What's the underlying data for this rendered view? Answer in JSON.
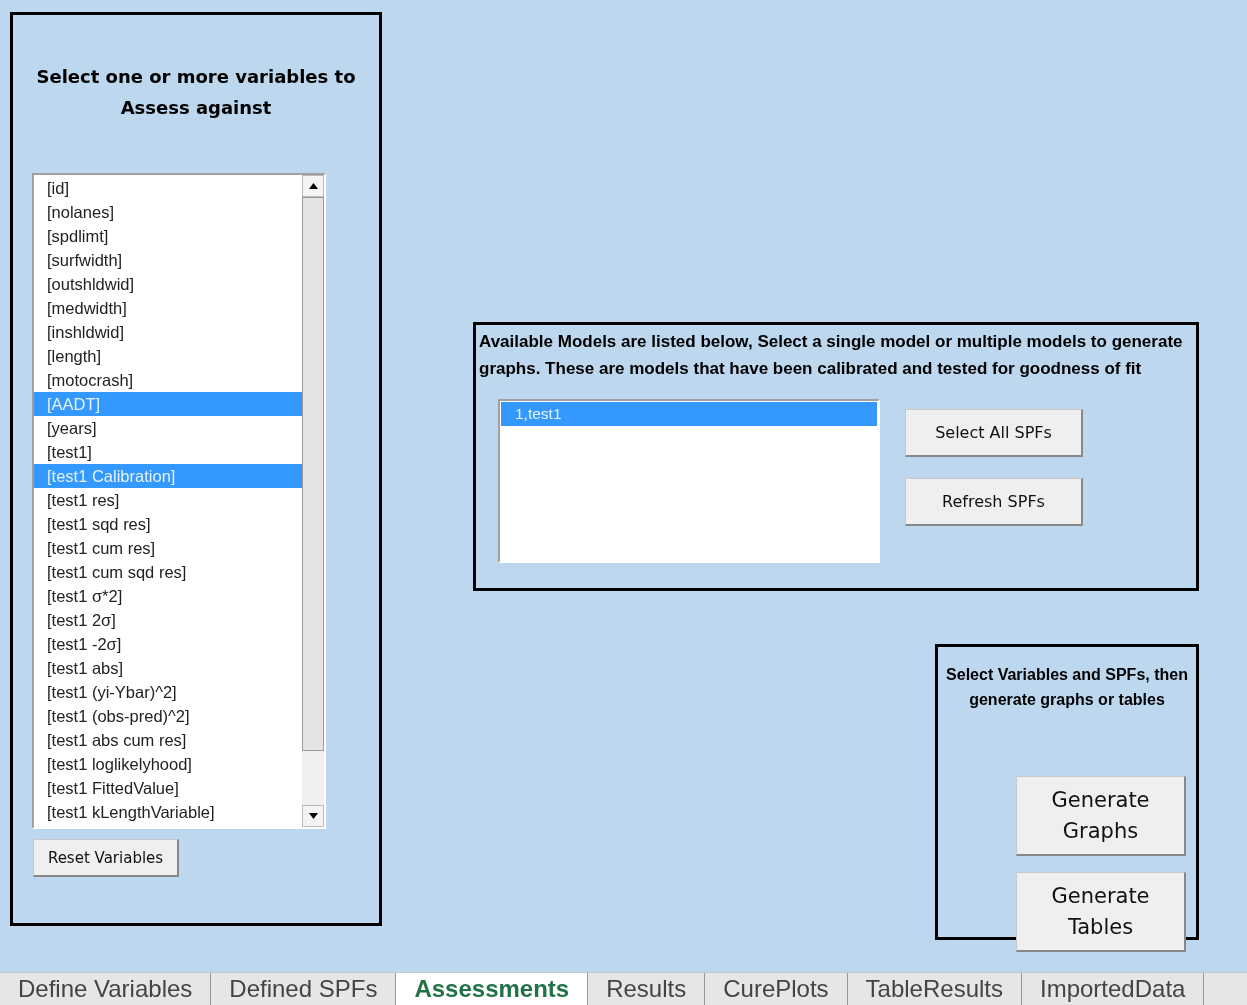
{
  "variables_panel": {
    "title": "Select one or more variables to Assess against",
    "items": [
      {
        "label": "[id]",
        "selected": false
      },
      {
        "label": "[nolanes]",
        "selected": false
      },
      {
        "label": "[spdlimt]",
        "selected": false
      },
      {
        "label": "[surfwidth]",
        "selected": false
      },
      {
        "label": "[outshldwid]",
        "selected": false
      },
      {
        "label": "[medwidth]",
        "selected": false
      },
      {
        "label": "[inshldwid]",
        "selected": false
      },
      {
        "label": "[length]",
        "selected": false
      },
      {
        "label": "[motocrash]",
        "selected": false
      },
      {
        "label": "[AADT]",
        "selected": true
      },
      {
        "label": "[years]",
        "selected": false
      },
      {
        "label": "[test1]",
        "selected": false
      },
      {
        "label": "[test1 Calibration]",
        "selected": true
      },
      {
        "label": "[test1 res]",
        "selected": false
      },
      {
        "label": "[test1 sqd res]",
        "selected": false
      },
      {
        "label": "[test1 cum res]",
        "selected": false
      },
      {
        "label": "[test1 cum sqd res]",
        "selected": false
      },
      {
        "label": "[test1 σ*2]",
        "selected": false
      },
      {
        "label": "[test1 2σ]",
        "selected": false
      },
      {
        "label": "[test1 -2σ]",
        "selected": false
      },
      {
        "label": "[test1 abs]",
        "selected": false
      },
      {
        "label": "[test1 (yi-Ybar)^2]",
        "selected": false
      },
      {
        "label": "[test1 (obs-pred)^2]",
        "selected": false
      },
      {
        "label": "[test1 abs cum res]",
        "selected": false
      },
      {
        "label": "[test1 loglikelyhood]",
        "selected": false
      },
      {
        "label": "[test1 FittedValue]",
        "selected": false
      },
      {
        "label": "[test1 kLengthVariable]",
        "selected": false
      }
    ],
    "reset_button": "Reset Variables"
  },
  "models_panel": {
    "description": "Available Models are listed below, Select a single model or multiple models to generate graphs.  These are models that have been calibrated and tested for goodness of fit",
    "items": [
      {
        "label": "1,test1",
        "selected": true
      }
    ],
    "buttons": [
      "Select All SPFs",
      "Refresh SPFs"
    ]
  },
  "generate_panel": {
    "description": "Select Variables and SPFs, then generate graphs or tables",
    "buttons": [
      "Generate Graphs",
      "Generate Tables"
    ]
  },
  "sheet_tabs": [
    {
      "label": "Define Variables",
      "selected": false
    },
    {
      "label": "Defined SPFs",
      "selected": false
    },
    {
      "label": "Assessments",
      "selected": true
    },
    {
      "label": "Results",
      "selected": false
    },
    {
      "label": "CurePlots",
      "selected": false
    },
    {
      "label": "TableResults",
      "selected": false
    },
    {
      "label": "ImportedData",
      "selected": false
    }
  ]
}
